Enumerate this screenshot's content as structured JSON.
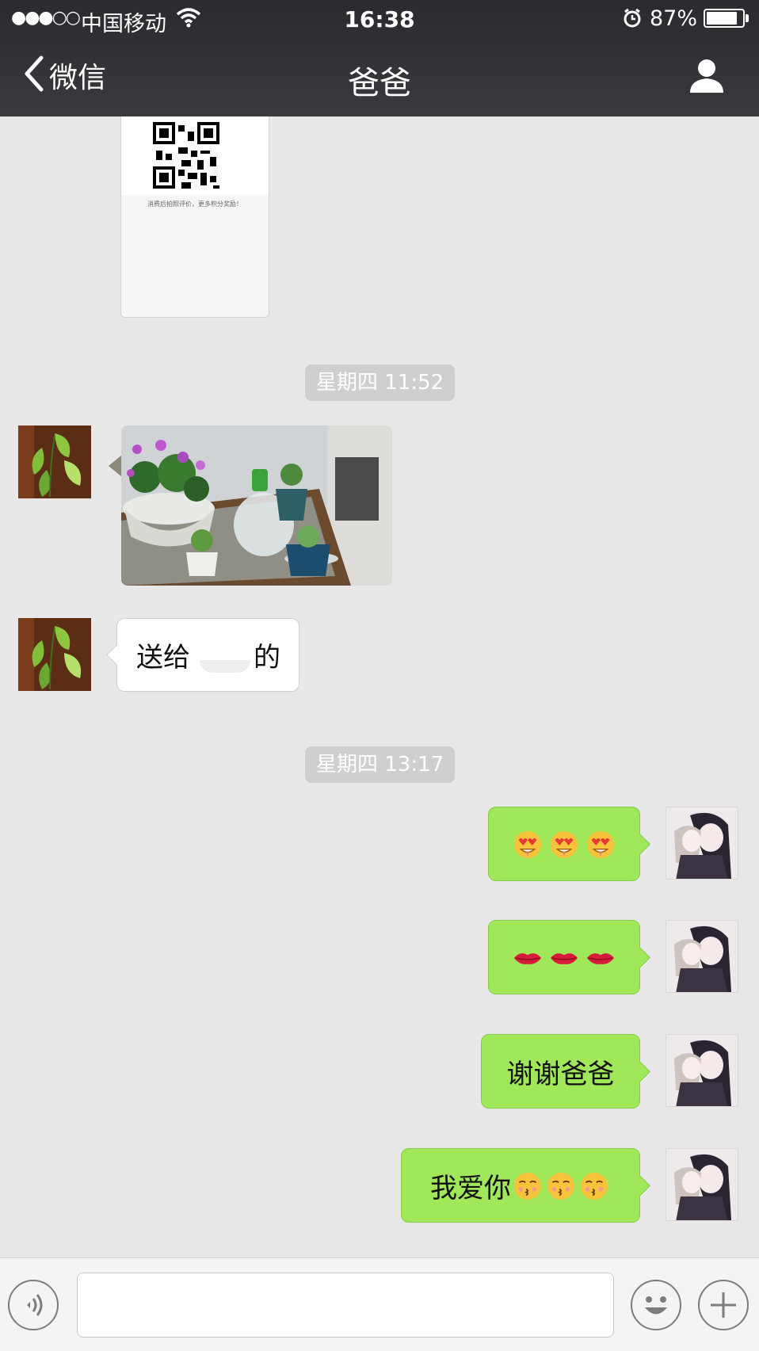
{
  "status_bar": {
    "signal": "●●●○○",
    "carrier": "中国移动",
    "time": "16:38",
    "battery_percent": "87%",
    "battery_level": 0.87,
    "icons": [
      "wifi-icon",
      "alarm-icon",
      "battery-icon"
    ]
  },
  "nav": {
    "back_label": "微信",
    "title": "爸爸",
    "profile_icon": "person-icon"
  },
  "chat": {
    "card_caption": "消费后拍照评价，更多积分奖励！",
    "timestamps": [
      "星期四 11:52",
      "星期四 13:17"
    ],
    "messages": [
      {
        "sender": "爸爸",
        "type": "image"
      },
      {
        "sender": "爸爸",
        "type": "text",
        "before": "送给",
        "after": "的"
      },
      {
        "sender": "me",
        "type": "emoji",
        "emojis": [
          "heart-eyes-emoji",
          "heart-eyes-emoji",
          "heart-eyes-emoji"
        ]
      },
      {
        "sender": "me",
        "type": "emoji",
        "emojis": [
          "lips-emoji",
          "lips-emoji",
          "lips-emoji"
        ]
      },
      {
        "sender": "me",
        "type": "text",
        "text": "谢谢爸爸"
      },
      {
        "sender": "me",
        "type": "text",
        "text": "我爱你",
        "emojis": [
          "kissing-emoji",
          "kissing-emoji",
          "kissing-emoji"
        ]
      }
    ]
  },
  "input_bar": {
    "voice_icon": "voice-icon",
    "text_value": "",
    "emoji_icon": "smiley-icon",
    "more_icon": "plus-icon"
  },
  "colors": {
    "nav_bg": "#2b2b2f",
    "chat_bg": "#e8e8e8",
    "outgoing_bubble": "#a0e75a",
    "incoming_bubble": "#ffffff",
    "timestamp_bg": "#cfcfcf"
  }
}
